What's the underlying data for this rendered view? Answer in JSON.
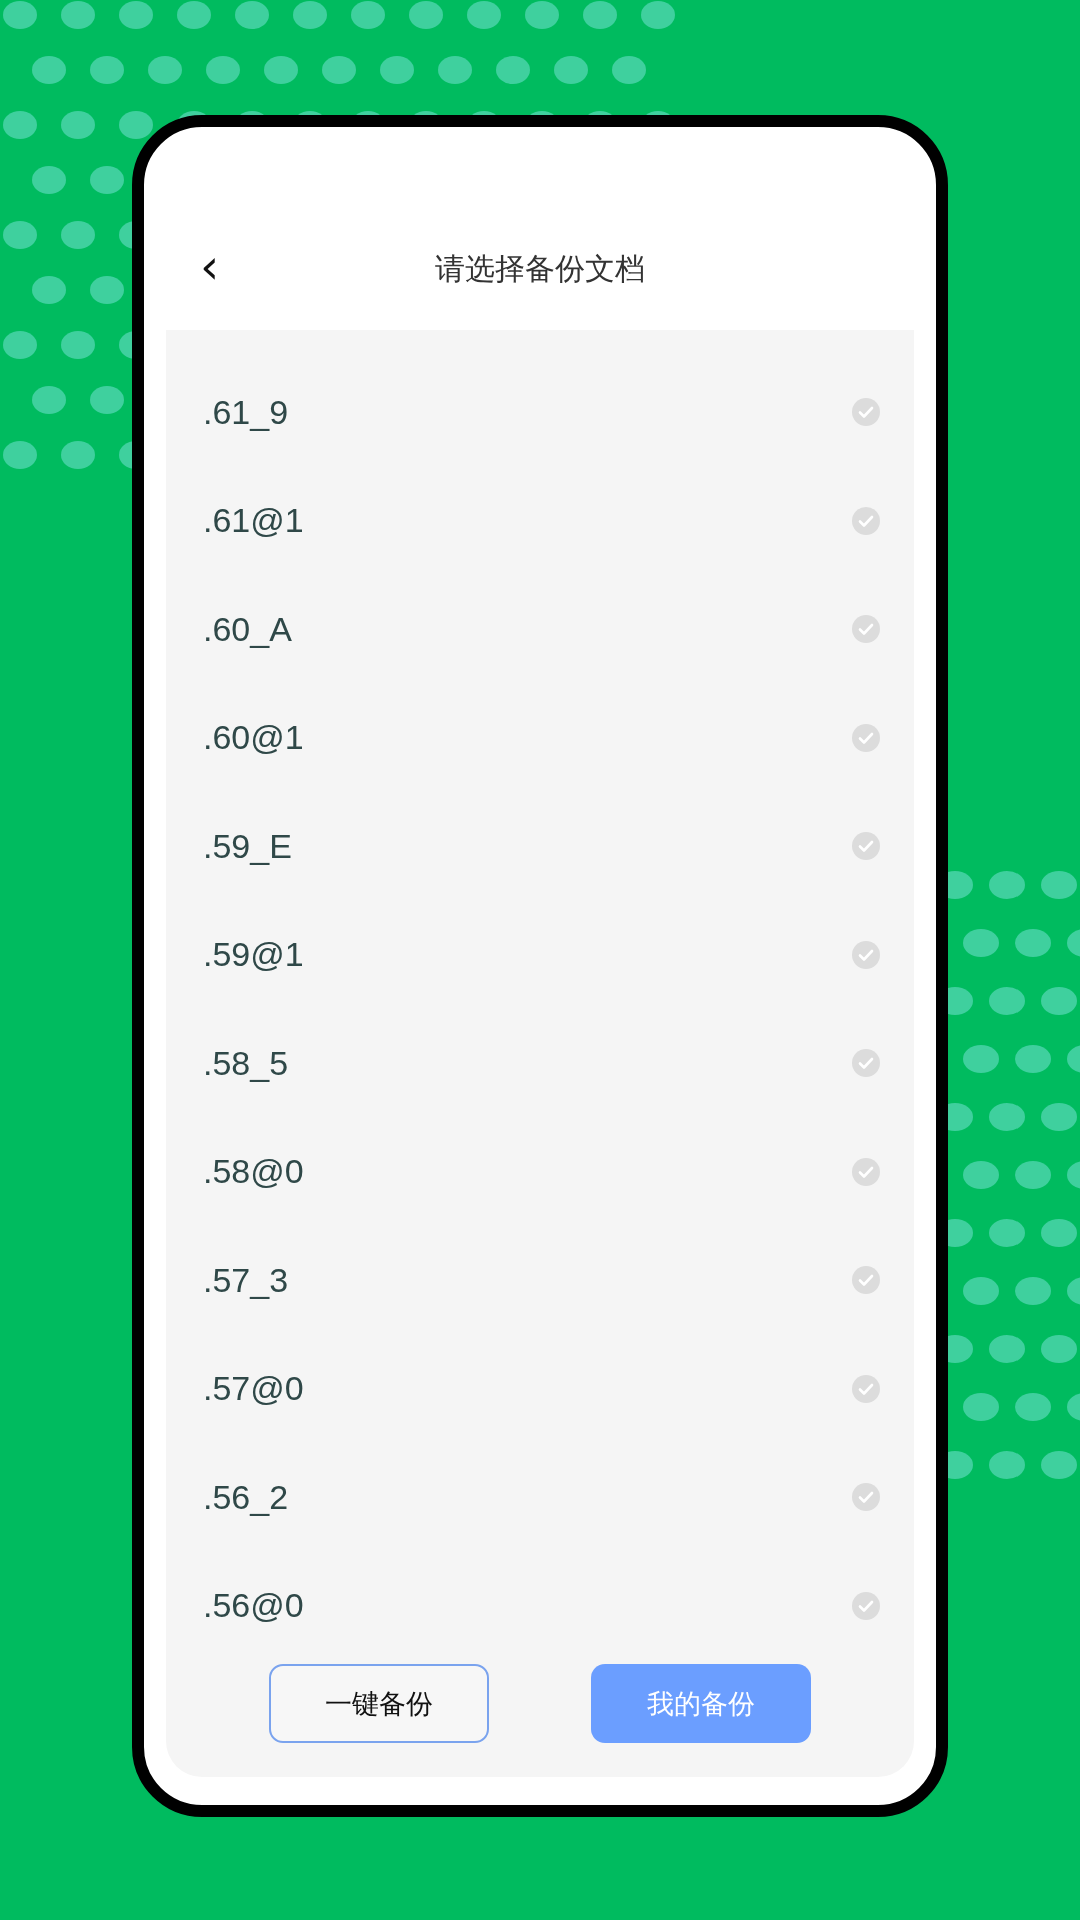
{
  "header": {
    "back": "‹",
    "title": "请选择备份文档"
  },
  "files": [
    {
      "name": ".61_9",
      "selected": false
    },
    {
      "name": ".61@1",
      "selected": false
    },
    {
      "name": ".60_A",
      "selected": false
    },
    {
      "name": ".60@1",
      "selected": false
    },
    {
      "name": ".59_E",
      "selected": false
    },
    {
      "name": ".59@1",
      "selected": false
    },
    {
      "name": ".58_5",
      "selected": false
    },
    {
      "name": ".58@0",
      "selected": false
    },
    {
      "name": ".57_3",
      "selected": false
    },
    {
      "name": ".57@0",
      "selected": false
    },
    {
      "name": ".56_2",
      "selected": false
    },
    {
      "name": ".56@0",
      "selected": false
    }
  ],
  "buttons": [
    {
      "label": "一键备份",
      "kind": "outline"
    },
    {
      "label": "我的备份",
      "kind": "filled"
    }
  ]
}
